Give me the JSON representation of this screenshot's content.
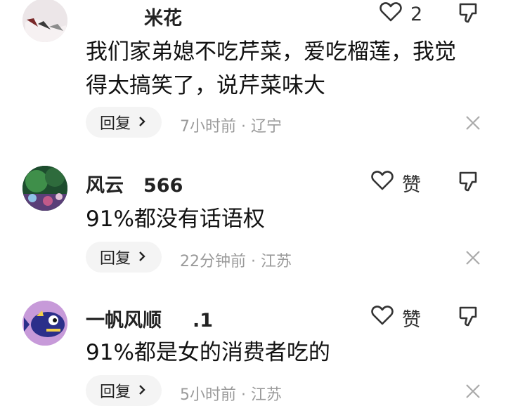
{
  "comments": [
    {
      "username": "米花",
      "like_label": "2",
      "text_line1": "我们家弟媳不吃芹菜，爱吃榴莲，我觉",
      "text_line2": "得太搞笑了，说芹菜味大",
      "reply_label": "回复",
      "time": "7小时前",
      "location": "辽宁",
      "like_icon": "heart-outline-icon",
      "dislike_icon": "thumbs-down-icon",
      "close_icon": "close-icon"
    },
    {
      "username": "风云",
      "username_suffix": "566",
      "like_label": "赞",
      "text_line1": "91%都没有话语权",
      "reply_label": "回复",
      "time": "22分钟前",
      "location": "江苏"
    },
    {
      "username": "一帆风顺",
      "username_suffix": ".1",
      "like_label": "赞",
      "text_line1": "91%都是女的消费者吃的",
      "reply_label": "回复",
      "time": "5小时前",
      "location": "江苏"
    }
  ],
  "separator": "·",
  "colors": {
    "text": "#111111",
    "meta": "#9a9a9a",
    "reply_bg": "#f4f4f4",
    "icon": "#333333"
  }
}
